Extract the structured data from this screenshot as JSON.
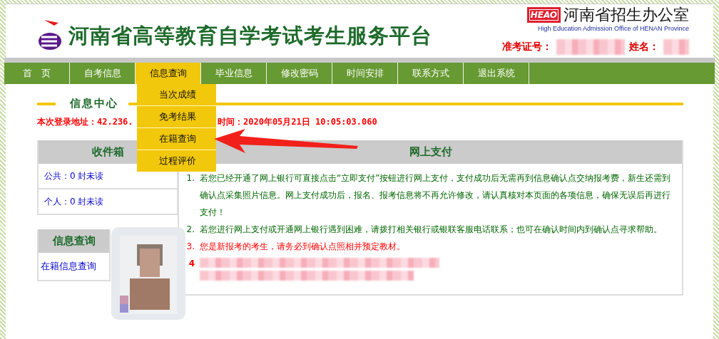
{
  "site": {
    "title": "河南省高等教育自学考试考生服务平台",
    "org_logo_text": "HEAO",
    "org_name": "河南省招生办公室",
    "org_english": "High Education Admission Office of HENAN Province",
    "fields": [
      {
        "label": "准考证号：",
        "redacted": true
      },
      {
        "label": "姓名：",
        "redacted": true
      }
    ]
  },
  "nav": [
    {
      "label": "首　页",
      "selected": false
    },
    {
      "label": "自考信息",
      "selected": false
    },
    {
      "label": "信息查询",
      "selected": true
    },
    {
      "label": "毕业信息",
      "selected": false
    },
    {
      "label": "修改密码",
      "selected": false
    },
    {
      "label": "时间安排",
      "selected": false
    },
    {
      "label": "联系方式",
      "selected": false
    },
    {
      "label": "退出系统",
      "selected": false
    }
  ],
  "dropdown": {
    "items": [
      "当次成绩",
      "免考结果",
      "在籍查询",
      "过程评价"
    ]
  },
  "section_title": "信息中心",
  "login_info": [
    "本次登录地址：42.236.",
    "时间：2020年05月21日 10:05:03.060"
  ],
  "inbox": {
    "title": "收件箱",
    "rows": [
      "公共：0 封未读",
      "个人：0 封未读"
    ]
  },
  "query": {
    "title": "信息查询",
    "links": [
      "在籍信息查询"
    ],
    "photo": {
      "kind": "picture"
    }
  },
  "payment": {
    "title": "网上支付",
    "items": [
      {
        "number": "1.",
        "text": "若您已经开通了网上银行可直接点击“立即支付”按钮进行网上支付，支付成功后无需再到信息确认点交纳报考费，新生还需到确认点采集照片信息。网上支付成功后，报名、报考信息将不再允许修改，请认真核对本页面的各项信息，确保无误后再进行支付！",
        "color": "#006600",
        "redacted": false
      },
      {
        "number": "2.",
        "text": "若您进行网上支付或开通网上银行遇到困难，请拨打相关银行或银联客服电话联系；也可在确认时间内到确认点寻求帮助。",
        "color": "#006600",
        "redacted": false
      },
      {
        "number": "3.",
        "text": "您是新报考的考生，请务必到确认点照相并预定教材。",
        "color": "#ff0000",
        "redacted": false
      },
      {
        "number": "4",
        "color": "#ff0000",
        "redacted": true
      }
    ]
  }
}
